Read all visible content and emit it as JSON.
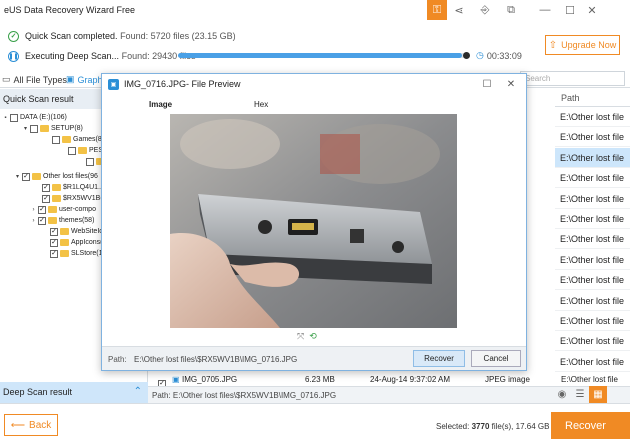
{
  "app": {
    "title": "eUS Data Recovery Wizard Free",
    "titlebar_icons": [
      "key-icon",
      "share-icon",
      "login-icon",
      "restore-icon",
      "minimize-icon",
      "maximize-icon",
      "close-icon"
    ]
  },
  "status": {
    "quick_label": "Quick Scan completed.",
    "quick_found": "Found: 5720 files (23.15 GB)",
    "deep_label": "Executing Deep Scan...",
    "deep_found": "Found: 29430 files",
    "deep_elapsed": "00:33:09",
    "deep_progress": 0.98
  },
  "upgrade_label": "Upgrade Now",
  "tabs": {
    "all": "All File Types",
    "graphics": "Graph"
  },
  "search_placeholder": "Search",
  "left_panel": {
    "quick_header": "Quick Scan result",
    "deep_header": "Deep Scan result",
    "tree": [
      {
        "label": "DATA (E:)(106)",
        "checked": false,
        "folder": false,
        "expand": "▪"
      },
      {
        "label": "SETUP(8)",
        "checked": false,
        "folder": true,
        "expand": "▾"
      },
      {
        "label": "Games(8)",
        "checked": false,
        "folder": true,
        "expand": ""
      },
      {
        "label": "PES 20",
        "checked": false,
        "folder": true,
        "expand": ""
      },
      {
        "label": "",
        "checked": false,
        "folder": true,
        "expand": ""
      },
      {
        "label": "Other lost files(96",
        "checked": true,
        "folder": true,
        "expand": "▾"
      },
      {
        "label": "$R1LQ4U1...",
        "checked": true,
        "folder": true,
        "expand": ""
      },
      {
        "label": "$RX5WV1B(",
        "checked": true,
        "folder": true,
        "expand": ""
      },
      {
        "label": "user-compo",
        "checked": true,
        "folder": true,
        "expand": "›"
      },
      {
        "label": "themes(58)",
        "checked": true,
        "folder": true,
        "expand": "›"
      },
      {
        "label": "WebSiteIcor",
        "checked": true,
        "folder": true,
        "expand": ""
      },
      {
        "label": "AppIcons(1",
        "checked": true,
        "folder": true,
        "expand": ""
      },
      {
        "label": "SLStore(1)",
        "checked": true,
        "folder": true,
        "expand": ""
      }
    ]
  },
  "file_list": {
    "path_header": "Path",
    "paths": [
      "E:\\Other lost file",
      "E:\\Other lost file",
      "E:\\Other lost file",
      "E:\\Other lost file",
      "E:\\Other lost file",
      "E:\\Other lost file",
      "E:\\Other lost file",
      "E:\\Other lost file",
      "E:\\Other lost file",
      "E:\\Other lost file",
      "E:\\Other lost file",
      "E:\\Other lost file",
      "E:\\Other lost file"
    ],
    "selected_index": 2,
    "bottom_row": {
      "name": "IMG_0705.JPG",
      "size": "6.23 MB",
      "date": "24-Aug-14 9:37:02 AM",
      "type": "JPEG image",
      "path": "E:\\Other lost file"
    }
  },
  "pathbar": {
    "label": "Path:",
    "value": "E:\\Other lost files\\$RX5WV1B\\IMG_0716.JPG"
  },
  "footer": {
    "back_label": "Back",
    "selected_prefix": "Selected:",
    "selected_count": "3770",
    "selected_suffix": "file(s), 17.64 GB",
    "recover_label": "Recover"
  },
  "dialog": {
    "title": "IMG_0716.JPG- File Preview",
    "tab_image": "Image",
    "tab_hex": "Hex",
    "path_label": "Path:",
    "path_value": "E:\\Other lost files\\$RX5WV1B\\IMG_0716.JPG",
    "recover_label": "Recover",
    "cancel_label": "Cancel"
  }
}
